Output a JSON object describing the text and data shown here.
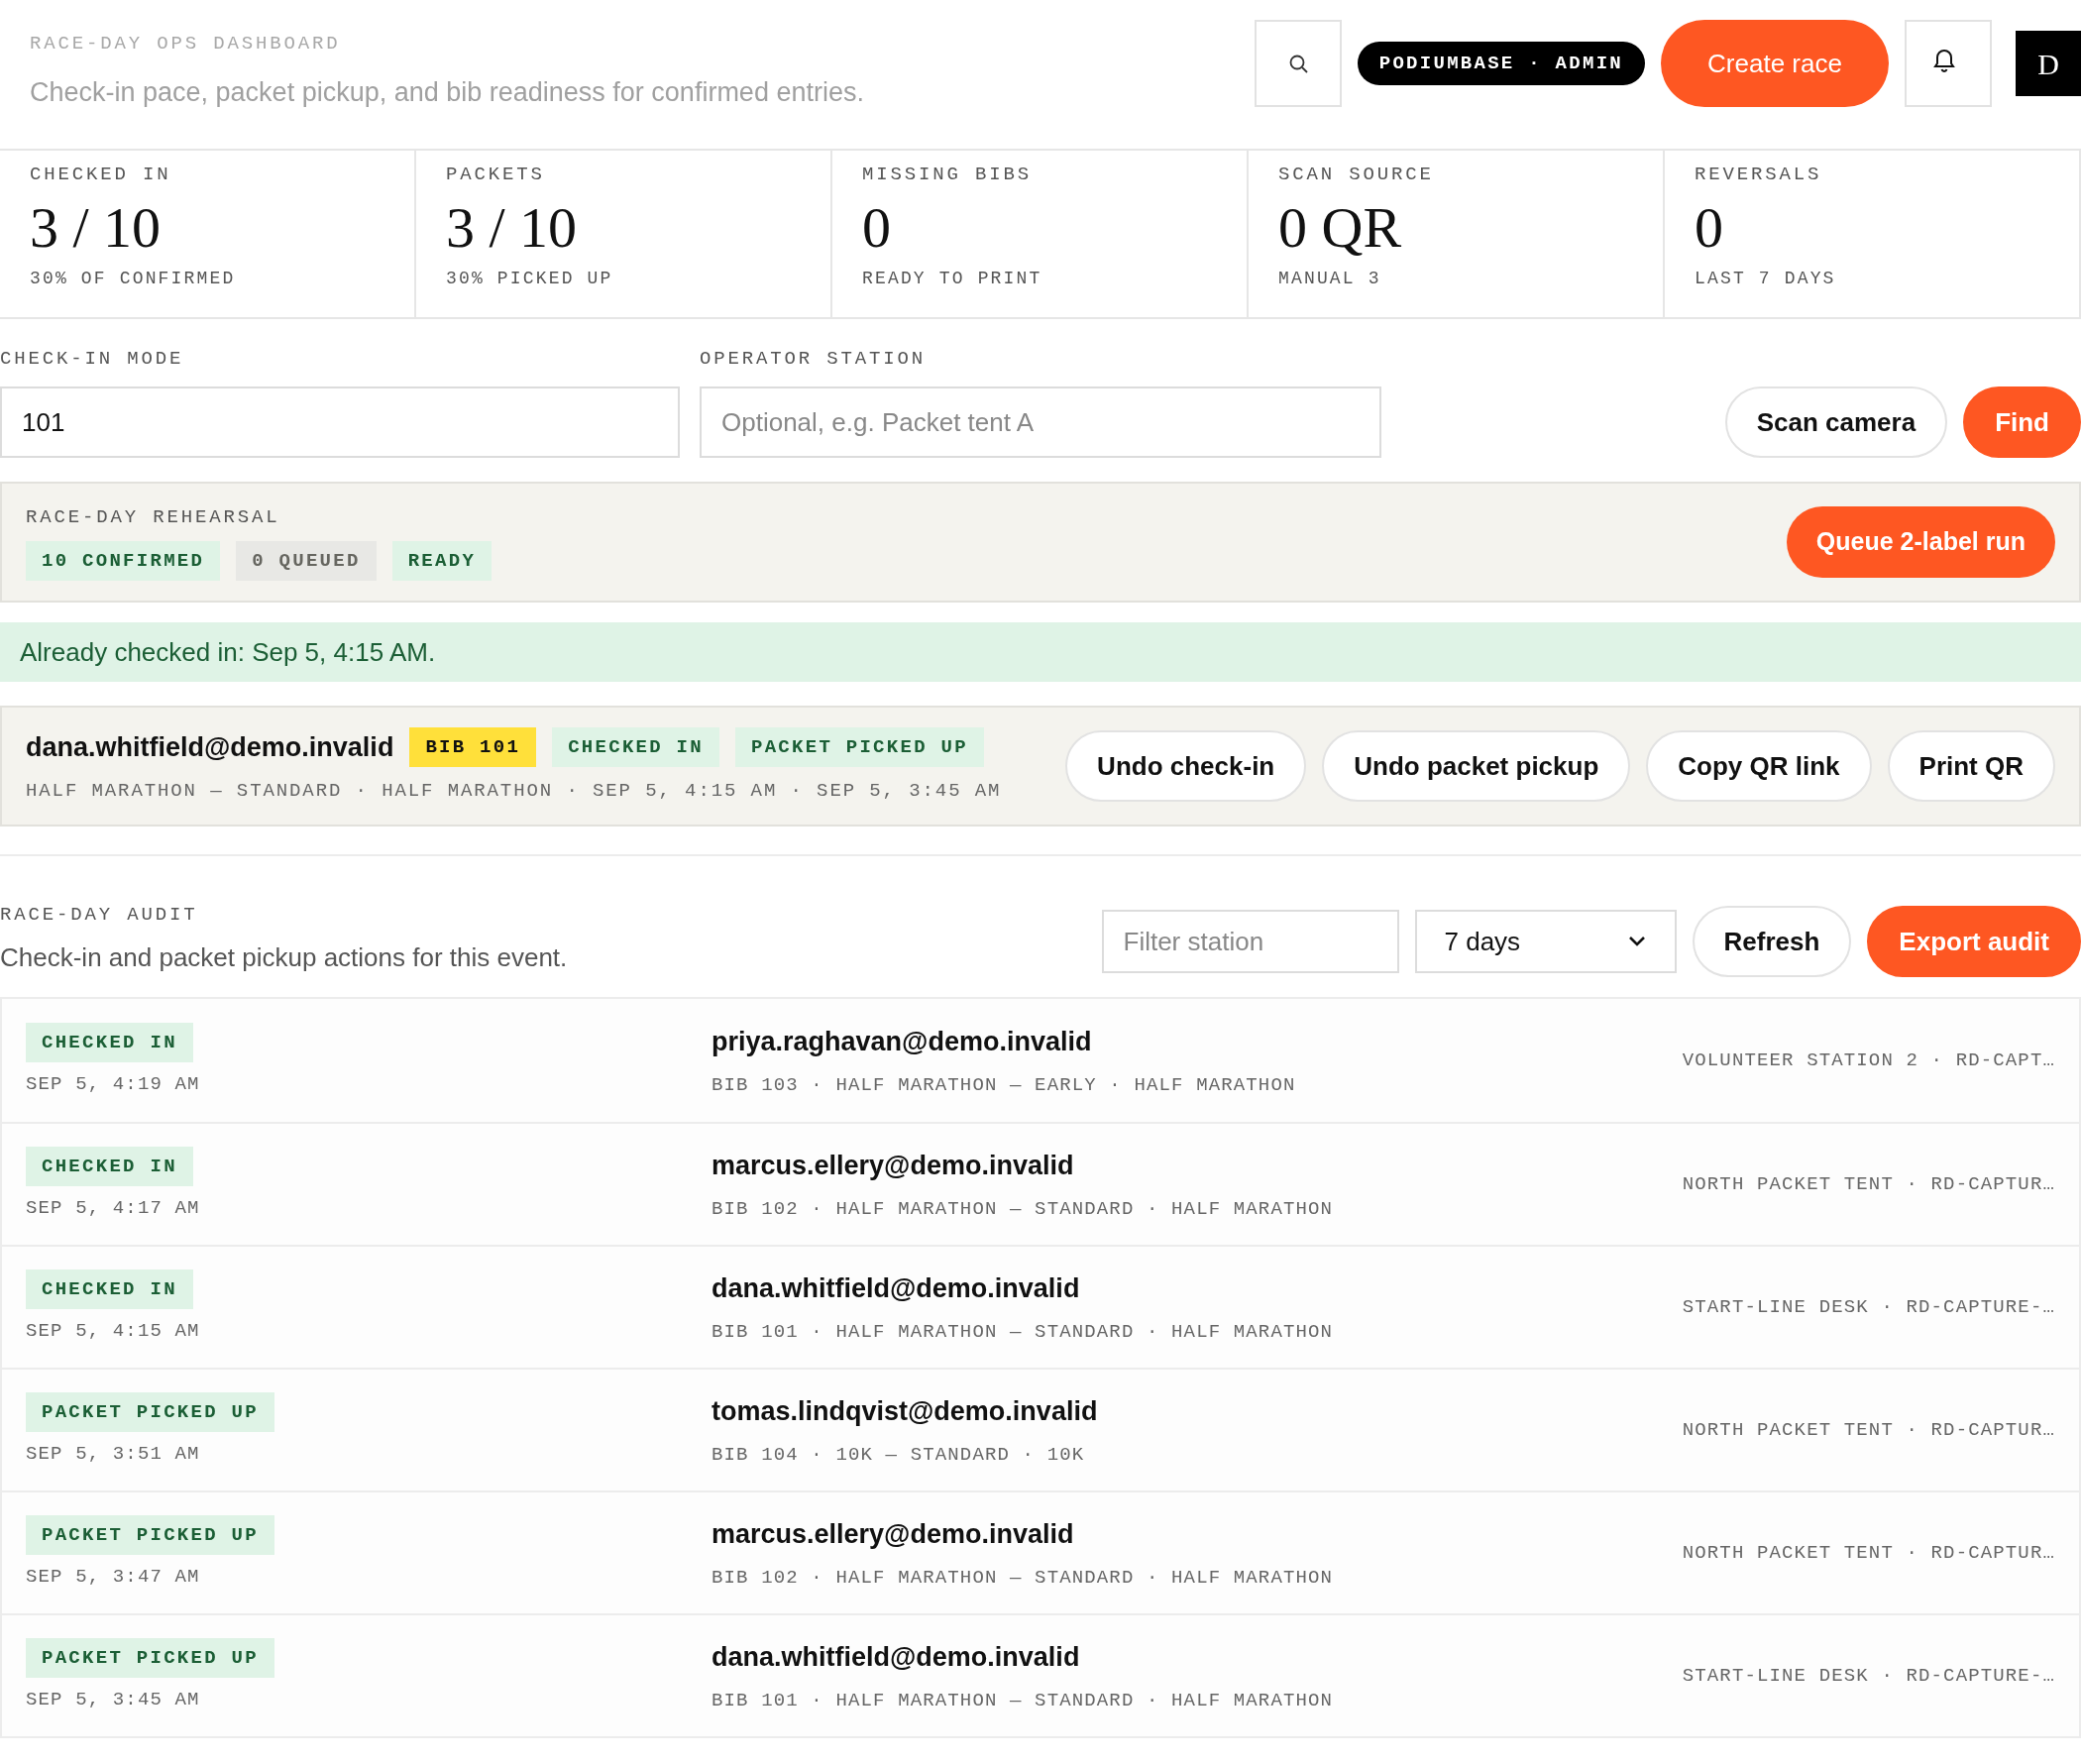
{
  "header": {
    "eyebrow": "RACE-DAY OPS DASHBOARD",
    "subtitle": "Check-in pace, packet pickup, and bib readiness for confirmed entries.",
    "account_badge": "PODIUMBASE · ADMIN",
    "create_button": "Create race",
    "avatar_initial": "D"
  },
  "stats": [
    {
      "label": "CHECKED IN",
      "value": "3 / 10",
      "caption": "30% OF CONFIRMED"
    },
    {
      "label": "PACKETS",
      "value": "3 / 10",
      "caption": "30% PICKED UP"
    },
    {
      "label": "MISSING BIBS",
      "value": "0",
      "caption": "READY TO PRINT"
    },
    {
      "label": "SCAN SOURCE",
      "value": "0 QR",
      "caption": "MANUAL 3"
    },
    {
      "label": "REVERSALS",
      "value": "0",
      "caption": "LAST 7 DAYS"
    }
  ],
  "form": {
    "fields": [
      {
        "label": "CHECK-IN MODE",
        "value": "101"
      },
      {
        "label": "OPERATOR STATION",
        "placeholder": "Optional, e.g. Packet tent A"
      }
    ],
    "buttons": [
      {
        "label": "Scan camera",
        "kind": "secondary"
      },
      {
        "label": "Find",
        "kind": "primary"
      }
    ]
  },
  "rehearsal": {
    "title": "RACE-DAY REHEARSAL",
    "tags": [
      {
        "label": "10 CONFIRMED",
        "kind": "success"
      },
      {
        "label": "0 QUEUED",
        "kind": "neutral"
      },
      {
        "label": "READY",
        "kind": "success"
      }
    ],
    "button": "Queue 2-label run"
  },
  "banner": {
    "text": "Already checked in: Sep 5, 4:15 AM."
  },
  "record": {
    "email": "dana.whitfield@demo.invalid",
    "tags": [
      {
        "label": "BIB 101",
        "kind": "bib"
      },
      {
        "label": "CHECKED IN",
        "kind": "success"
      },
      {
        "label": "PACKET PICKED UP",
        "kind": "success"
      }
    ],
    "meta": "HALF MARATHON — STANDARD · HALF MARATHON · SEP 5, 4:15 AM · SEP 5, 3:45 AM",
    "buttons": [
      "Undo check-in",
      "Undo packet pickup",
      "Copy QR link",
      "Print QR"
    ]
  },
  "audit": {
    "title": "RACE-DAY AUDIT",
    "description": "Check-in and packet pickup actions for this event.",
    "filter": {
      "placeholder": "Filter station"
    },
    "range": {
      "value": "7 days"
    },
    "buttons": [
      {
        "label": "Refresh",
        "kind": "secondary"
      },
      {
        "label": "Export audit",
        "kind": "primary"
      }
    ],
    "rows": [
      {
        "action": "CHECKED IN",
        "time": "SEP 5, 4:19 AM",
        "email": "priya.raghavan@demo.invalid",
        "details": "BIB 103 · HALF MARATHON — EARLY · HALF MARATHON",
        "station": "VOLUNTEER STATION 2 · RD-CAPT…"
      },
      {
        "action": "CHECKED IN",
        "time": "SEP 5, 4:17 AM",
        "email": "marcus.ellery@demo.invalid",
        "details": "BIB 102 · HALF MARATHON — STANDARD · HALF MARATHON",
        "station": "NORTH PACKET TENT · RD-CAPTUR…"
      },
      {
        "action": "CHECKED IN",
        "time": "SEP 5, 4:15 AM",
        "email": "dana.whitfield@demo.invalid",
        "details": "BIB 101 · HALF MARATHON — STANDARD · HALF MARATHON",
        "station": "START-LINE DESK · RD-CAPTURE-…"
      },
      {
        "action": "PACKET PICKED UP",
        "time": "SEP 5, 3:51 AM",
        "email": "tomas.lindqvist@demo.invalid",
        "details": "BIB 104 · 10K — STANDARD · 10K",
        "station": "NORTH PACKET TENT · RD-CAPTUR…"
      },
      {
        "action": "PACKET PICKED UP",
        "time": "SEP 5, 3:47 AM",
        "email": "marcus.ellery@demo.invalid",
        "details": "BIB 102 · HALF MARATHON — STANDARD · HALF MARATHON",
        "station": "NORTH PACKET TENT · RD-CAPTUR…"
      },
      {
        "action": "PACKET PICKED UP",
        "time": "SEP 5, 3:45 AM",
        "email": "dana.whitfield@demo.invalid",
        "details": "BIB 101 · HALF MARATHON — STANDARD · HALF MARATHON",
        "station": "START-LINE DESK · RD-CAPTURE-…"
      }
    ]
  }
}
